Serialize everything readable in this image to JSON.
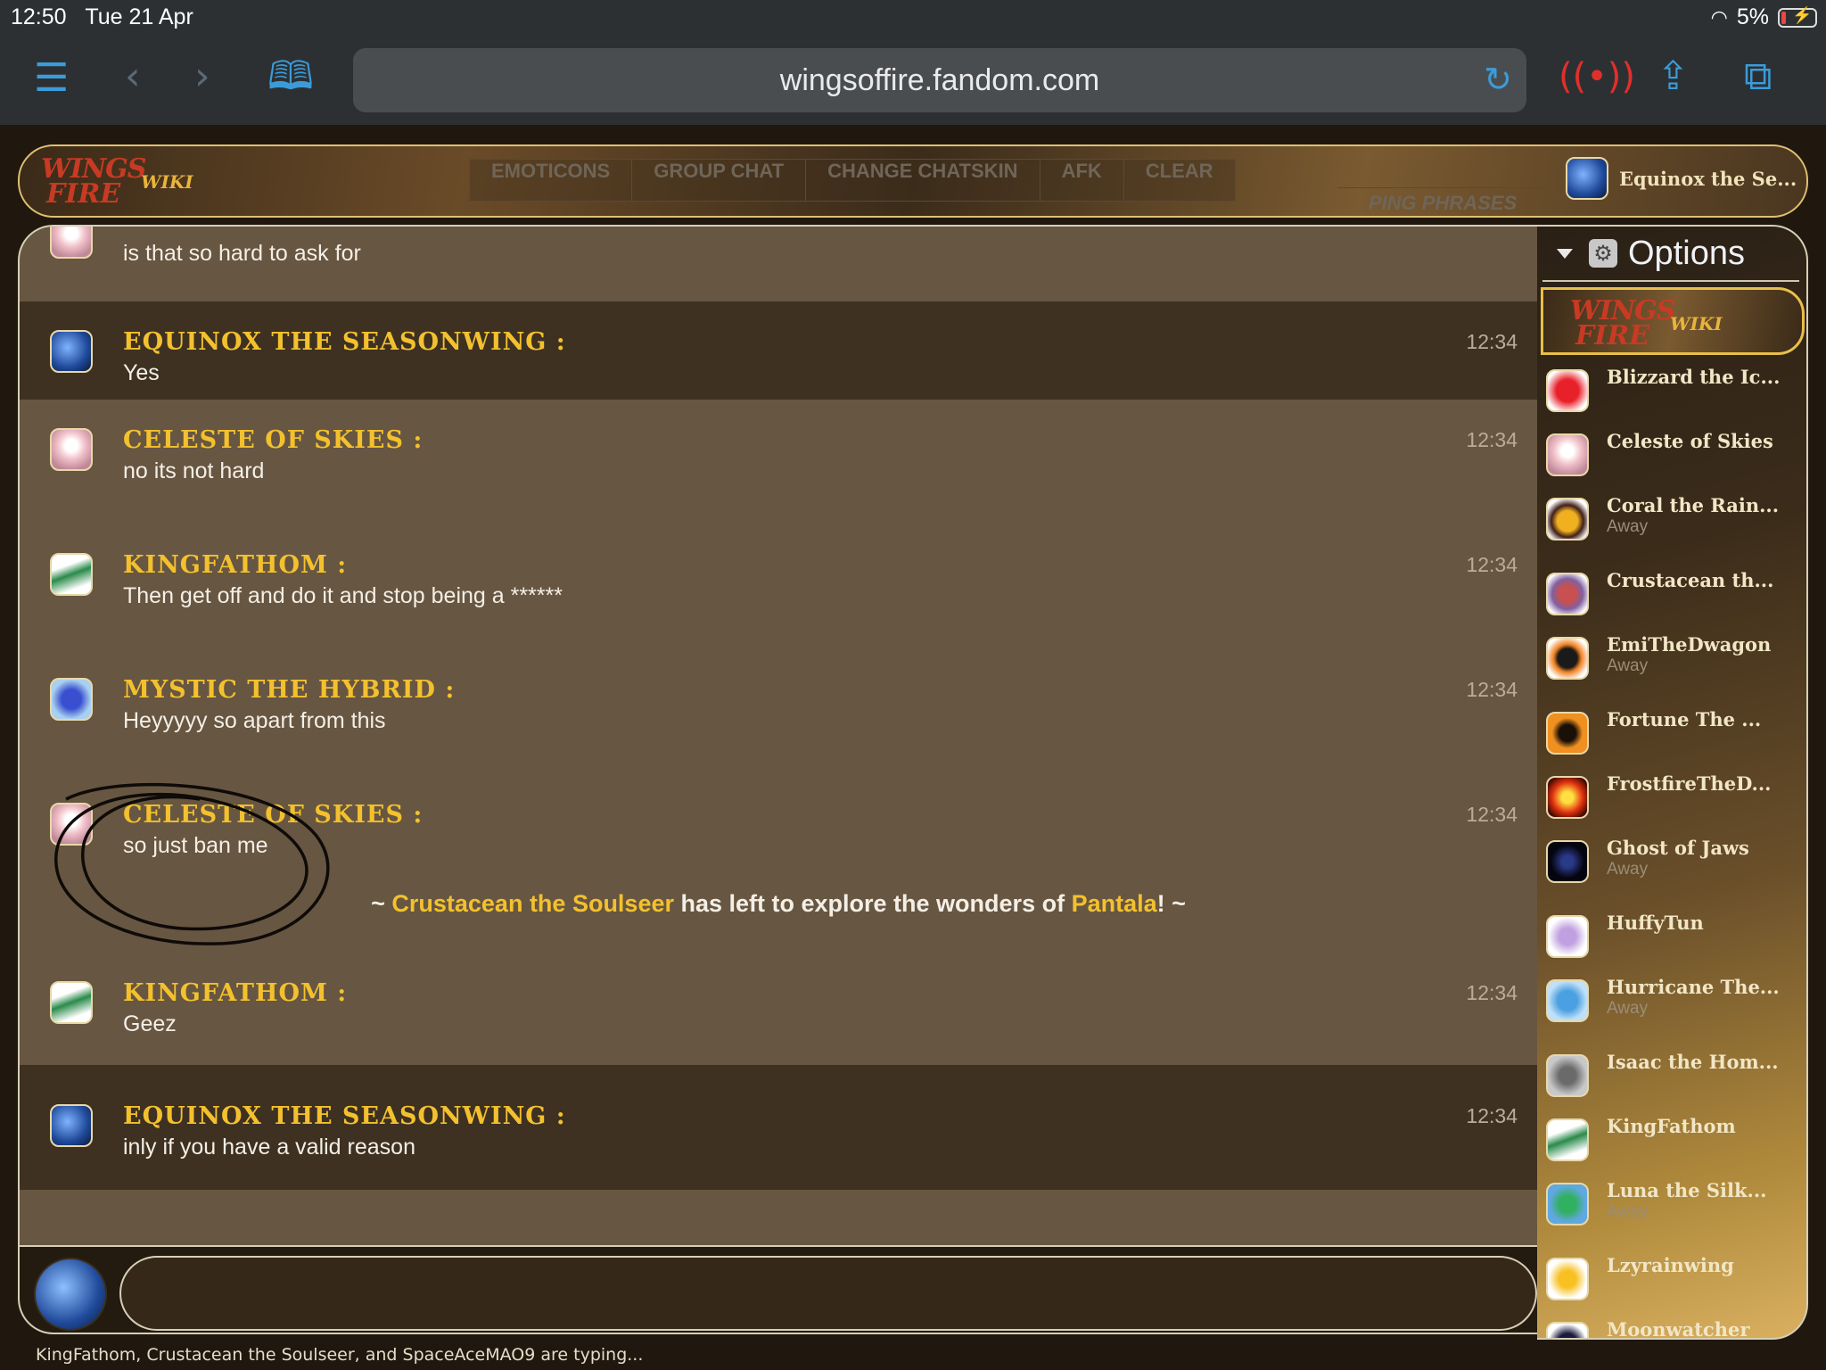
{
  "status_bar": {
    "time": "12:50",
    "date": "Tue 21 Apr",
    "battery": "5%"
  },
  "browser": {
    "url": "wingsoffire.fandom.com",
    "icons": [
      "menu-icon",
      "back-icon",
      "forward-icon",
      "bookmarks-icon",
      "reload-icon",
      "broadcast-icon",
      "share-icon",
      "tabs-icon"
    ]
  },
  "header": {
    "logo_lines": [
      "WINGS",
      "FIRE",
      "WIKI"
    ],
    "buttons": [
      "EMOTICONS",
      "GROUP CHAT",
      "CHANGE CHATSKIN",
      "AFK",
      "CLEAR"
    ],
    "ping_phrases": "PING PHRASES",
    "self_user": "Equinox the Se..."
  },
  "messages": [
    {
      "user": "",
      "text": "is that so hard to ask for",
      "time": "",
      "avatar": "celeste",
      "dark": false
    },
    {
      "user": "EQUINOX THE SEASONWING :",
      "text": "Yes",
      "time": "12:34",
      "avatar": "earth",
      "dark": true
    },
    {
      "user": "CELESTE OF SKIES :",
      "text": "no its not hard",
      "time": "12:34",
      "avatar": "celeste",
      "dark": false
    },
    {
      "user": "KINGFATHOM :",
      "text": "Then get off and do it and stop being a ******",
      "time": "12:34",
      "avatar": "king",
      "dark": false
    },
    {
      "user": "MYSTIC THE HYBRID :",
      "text": "Heyyyyy so apart from this",
      "time": "12:34",
      "avatar": "mystic",
      "dark": false
    },
    {
      "user": "CELESTE OF SKIES :",
      "text": "so just ban me",
      "time": "12:34",
      "avatar": "celeste",
      "dark": false
    },
    {
      "user": "KINGFATHOM :",
      "text": "Geez",
      "time": "12:34",
      "avatar": "king",
      "dark": false
    },
    {
      "user": "EQUINOX THE SEASONWING :",
      "text": "inly if you have a valid reason",
      "time": "12:34",
      "avatar": "earth",
      "dark": true
    }
  ],
  "system_message": {
    "prefix": "~ ",
    "user": "Crustacean the Soulseer",
    "middle": " has left to explore the wonders of ",
    "place": "Pantala",
    "suffix": "! ~"
  },
  "input": {
    "placeholder": ""
  },
  "typing": {
    "users": [
      "KingFathom",
      "Crustacean the Soulseer",
      "SpaceAceMAO9"
    ],
    "text": "KingFathom, Crustacean the Soulseer, and SpaceAceMAO9 are typing..."
  },
  "sidebar": {
    "options_label": "Options",
    "users": [
      {
        "name": "Blizzard the Ic...",
        "status": "",
        "avatar": "red"
      },
      {
        "name": "Celeste of Skies",
        "status": "",
        "avatar": "celeste"
      },
      {
        "name": "Coral the Rain...",
        "status": "Away",
        "avatar": "coral"
      },
      {
        "name": "Crustacean th...",
        "status": "",
        "avatar": "crust"
      },
      {
        "name": "EmiTheDwagon",
        "status": "Away",
        "avatar": "emi"
      },
      {
        "name": "Fortune The ...",
        "status": "",
        "avatar": "fortune"
      },
      {
        "name": "FrostfireTheD...",
        "status": "",
        "avatar": "frost"
      },
      {
        "name": "Ghost of Jaws",
        "status": "Away",
        "avatar": "ghost"
      },
      {
        "name": "HuffyTun",
        "status": "",
        "avatar": "huffy"
      },
      {
        "name": "Hurricane The...",
        "status": "Away",
        "avatar": "hurr"
      },
      {
        "name": "Isaac the Hom...",
        "status": "",
        "avatar": "isaac"
      },
      {
        "name": "KingFathom",
        "status": "",
        "avatar": "king"
      },
      {
        "name": "Luna the Silk...",
        "status": "Away",
        "avatar": "luna"
      },
      {
        "name": "Lzyrainwing",
        "status": "",
        "avatar": "lzy"
      },
      {
        "name": "Moonwatcher",
        "status": "",
        "avatar": "moon"
      }
    ]
  }
}
